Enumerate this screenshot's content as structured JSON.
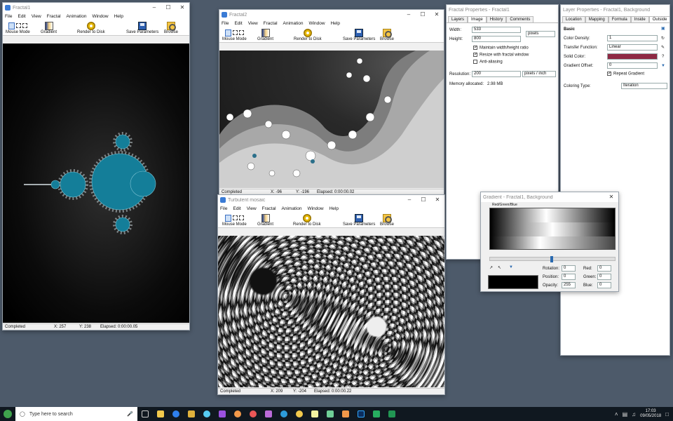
{
  "menu_items": [
    "File",
    "Edit",
    "View",
    "Fractal",
    "Animation",
    "Window",
    "Help"
  ],
  "toolbar": {
    "mouse_mode": "Mouse Mode",
    "gradient": "Gradient",
    "render": "Render to Disk",
    "save_params": "Save Parameters",
    "browse": "Browse"
  },
  "fractal1": {
    "title": "Fractal1",
    "status": "Completed",
    "x": "X: 257",
    "y": "Y: 238",
    "elapsed": "Elapsed: 0:00:00.05"
  },
  "fractal2": {
    "title": "Fractal2",
    "status": "Completed",
    "x": "X: -96",
    "y": "Y: -196",
    "elapsed": "Elapsed: 0:00:00.02"
  },
  "turbulent": {
    "title": "Turbulent mosaic",
    "status": "Completed",
    "x": "X: 209",
    "y": "Y: -204",
    "elapsed": "Elapsed: 0:00:00.22"
  },
  "fractal_props": {
    "title": "Fractal Properties - Fractal1",
    "tabs": [
      "Layers",
      "Image",
      "History",
      "Comments"
    ],
    "width_label": "Width:",
    "width_value": "533",
    "height_label": "Height:",
    "height_value": "800",
    "unit": "pixels",
    "maintain": "Maintain width/height ratio",
    "resize": "Resize with fractal window",
    "antialias": "Anti-aliasing",
    "resolution_label": "Resolution:",
    "resolution_value": "200",
    "resolution_unit": "pixels / inch",
    "memory_label": "Memory allocated:",
    "memory_value": "2.98 MB"
  },
  "layer_props": {
    "title": "Layer Properties - Fractal1, Background",
    "tabs": [
      "Location",
      "Mapping",
      "Formula",
      "Inside",
      "Outside"
    ],
    "section": "Basic",
    "color_density_label": "Color Density:",
    "color_density": "1",
    "transfer_label": "Transfer Function:",
    "transfer": "Linear",
    "solid_label": "Solid Color:",
    "gradient_offset_label": "Gradient Offset:",
    "gradient_offset": "0",
    "repeat": "Repeat Gradient",
    "coloring_label": "Coloring Type:",
    "coloring": "Iteration",
    "solid_color": "#8e2a44"
  },
  "gradient_win": {
    "title": "Gradient - Fractal1, Background",
    "channel": "Red/Green/Blue",
    "rotation_label": "Rotation:",
    "rotation": "0",
    "position_label": "Position:",
    "position": "0",
    "opacity_label": "Opacity:",
    "opacity": "255",
    "red_label": "Red:",
    "red": "0",
    "green_label": "Green:",
    "green": "0",
    "blue_label": "Blue:",
    "blue": "0"
  },
  "taskbar": {
    "search_placeholder": "Type here to search",
    "time": "17:03",
    "date": "09/05/2018"
  },
  "colors": {
    "desktop": "#4d5a6a",
    "mandel_fill": "#147e99"
  }
}
